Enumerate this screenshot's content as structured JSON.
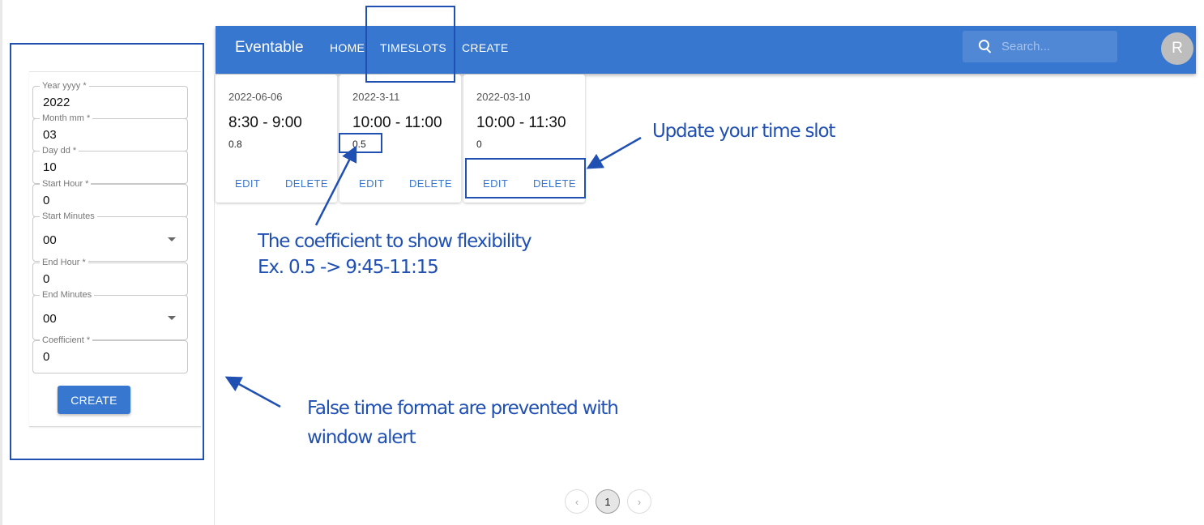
{
  "form": {
    "fields": [
      {
        "label": "Year yyyy *",
        "value": "2022"
      },
      {
        "label": "Month mm *",
        "value": "03"
      },
      {
        "label": "Day dd *",
        "value": "10"
      },
      {
        "label": "Start Hour *",
        "value": "0"
      },
      {
        "label": "Start Minutes",
        "value": "00"
      },
      {
        "label": "End Hour *",
        "value": "0"
      },
      {
        "label": "End Minutes",
        "value": "00"
      },
      {
        "label": "Coefficient *",
        "value": "0"
      }
    ],
    "create_label": "CREATE"
  },
  "appbar": {
    "brand": "Eventable",
    "nav": [
      "HOME",
      "TIMESLOTS",
      "CREATE"
    ],
    "search_placeholder": "Search...",
    "avatar": "R",
    "color": "#3777d0"
  },
  "cards": [
    {
      "date": "2022-06-06",
      "time": "8:30 - 9:00",
      "coef": "0.8",
      "edit": "EDIT",
      "delete": "DELETE"
    },
    {
      "date": "2022-3-11",
      "time": "10:00 - 11:00",
      "coef": "0.5",
      "edit": "EDIT",
      "delete": "DELETE"
    },
    {
      "date": "2022-03-10",
      "time": "10:00 - 11:30",
      "coef": "0",
      "edit": "EDIT",
      "delete": "DELETE"
    }
  ],
  "pagination": {
    "prev": "‹",
    "current": "1",
    "next": "›"
  },
  "annotations": {
    "update": "Update your time slot",
    "coef_line1": "The coefficient to show flexibility",
    "coef_line2": "Ex. 0.5 -> 9:45-11:15",
    "false_line1": "False time format are prevented with",
    "false_line2": "window alert",
    "color": "#2150b3"
  },
  "icons": {
    "search": "search-icon",
    "select": "chevron-down-icon",
    "arrow": "arrow-icon"
  }
}
